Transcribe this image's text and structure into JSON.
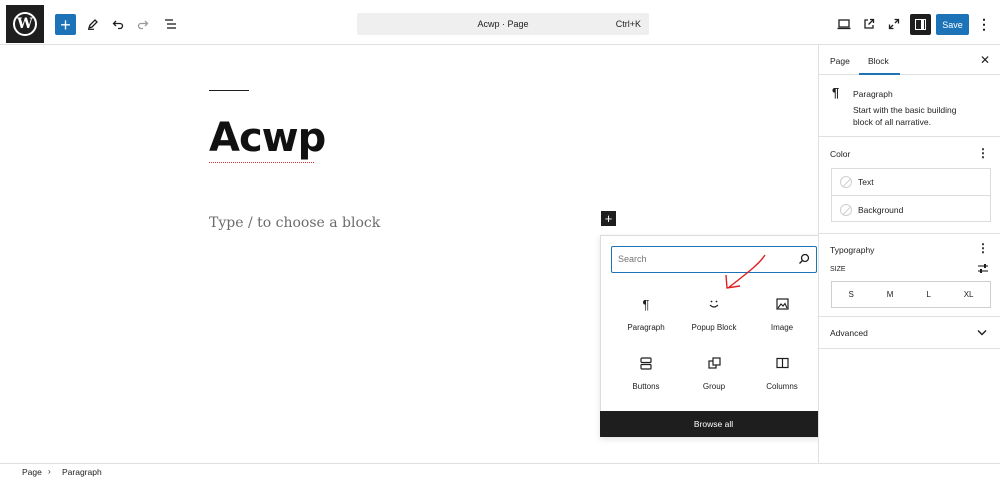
{
  "topbar": {
    "logo_letter": "W",
    "document_title": "Acwp · Page",
    "shortcut": "Ctrl+K",
    "save_label": "Save"
  },
  "canvas": {
    "title": "Acwp",
    "placeholder": "Type / to choose a block"
  },
  "inserter": {
    "search_placeholder": "Search",
    "blocks": [
      {
        "label": "Paragraph",
        "icon": "paragraph-icon"
      },
      {
        "label": "Popup Block",
        "icon": "smiley-icon"
      },
      {
        "label": "Image",
        "icon": "image-icon"
      },
      {
        "label": "Buttons",
        "icon": "buttons-icon"
      },
      {
        "label": "Group",
        "icon": "group-icon"
      },
      {
        "label": "Columns",
        "icon": "columns-icon"
      }
    ],
    "browse_all": "Browse all"
  },
  "sidebar": {
    "tabs": [
      {
        "label": "Page"
      },
      {
        "label": "Block"
      }
    ],
    "active_tab": "Block",
    "block": {
      "name": "Paragraph",
      "description": "Start with the basic building block of all narrative."
    },
    "color": {
      "heading": "Color",
      "items": [
        {
          "label": "Text"
        },
        {
          "label": "Background"
        }
      ]
    },
    "typography": {
      "heading": "Typography",
      "size_label": "SIZE",
      "sizes": [
        "S",
        "M",
        "L",
        "XL"
      ]
    },
    "advanced": {
      "heading": "Advanced"
    }
  },
  "footer": {
    "breadcrumb": [
      "Page",
      "Paragraph"
    ]
  },
  "colors": {
    "accent": "#1c73b8",
    "dark": "#1e1e1e",
    "annotation": "#e02020"
  }
}
